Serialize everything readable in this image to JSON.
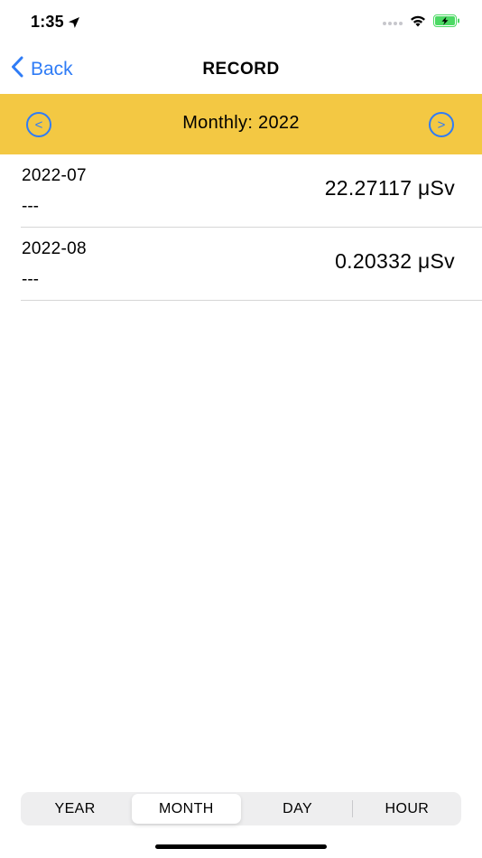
{
  "status_bar": {
    "time": "1:35",
    "icons": [
      "location-arrow-icon",
      "signal-icon",
      "wifi-icon",
      "battery-charging-icon"
    ]
  },
  "nav": {
    "back_label": "Back",
    "title": "RECORD"
  },
  "period": {
    "title": "Monthly: 2022",
    "prev_symbol": "<",
    "next_symbol": ">"
  },
  "records": [
    {
      "date": "2022-07",
      "note": "---",
      "value": "22.27117 μSv"
    },
    {
      "date": "2022-08",
      "note": "---",
      "value": "0.20332 μSv"
    }
  ],
  "segments": {
    "selected": "MONTH",
    "items": [
      "YEAR",
      "MONTH",
      "DAY",
      "HOUR"
    ]
  },
  "colors": {
    "accent": "#2f7cf6",
    "header_bg": "#f3c843",
    "battery": "#4cd964"
  }
}
